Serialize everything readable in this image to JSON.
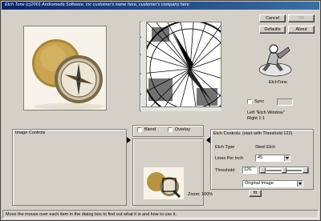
{
  "window": {
    "title": "Etch Tone (c)2001 Andromeda Software, Inc  customer's name here, customer's company here"
  },
  "buttons": {
    "cancel": "Cancel",
    "ok": "OK",
    "defaults": "Defaults",
    "about": "About"
  },
  "preview": {
    "sync_label": "Sync",
    "hint_line1": "Left \"Etch Window\"",
    "hint_line2": "Right 1:1",
    "logo_caption": "EtchTone"
  },
  "left_panel": {
    "title": "Image Controls"
  },
  "middle_panel": {
    "blend_label": "Blend",
    "overlay_label": "Overlay",
    "zoom_label": "Zoom: 100%",
    "zoom_button": "fit"
  },
  "right_panel": {
    "title": "Etch Controls: (start with Threshold 122)",
    "etch_type_label": "Etch Type",
    "etch_type_value": "Steel Etch",
    "lines_per_inch_label": "Lines Per Inch",
    "lines_per_inch_value": "45",
    "threshold_label": "Threshold",
    "threshold_value": "126",
    "threshold_level": 0.49,
    "source_value": "Original Image"
  },
  "status": {
    "text": "Move the mouse over each item in the dialog box to find out what it is and how to use it."
  },
  "colors": {
    "face": "#d4d0c8",
    "titlebar": "#0a246a"
  }
}
